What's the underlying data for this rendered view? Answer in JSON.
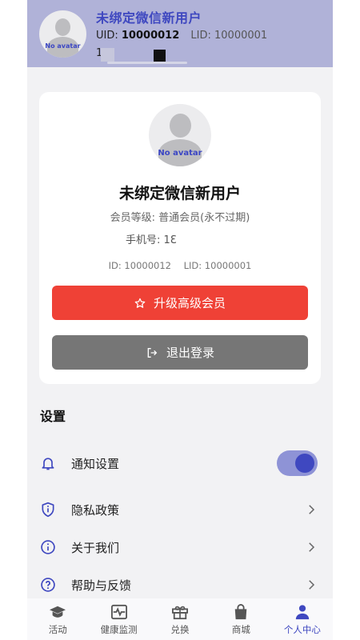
{
  "header": {
    "avatar_text": "No avatar",
    "name": "未绑定微信新用户",
    "uid_label": "UID:",
    "uid": "10000012",
    "lid": "LID: 10000001",
    "phone_partial": "1"
  },
  "card": {
    "avatar_text": "No avatar",
    "name": "未绑定微信新用户",
    "member_level": "会员等级: 普通会员(永不过期)",
    "phone": "手机号: 1Ɛ",
    "id": "ID: 10000012",
    "lid": "LID: 10000001",
    "upgrade_label": "升级高级会员",
    "logout_label": "退出登录"
  },
  "settings": {
    "title": "设置",
    "items": [
      {
        "label": "通知设置",
        "icon": "bell-icon",
        "control": "toggle",
        "on": true
      },
      {
        "label": "隐私政策",
        "icon": "shield-info-icon",
        "control": "chevron"
      },
      {
        "label": "关于我们",
        "icon": "info-icon",
        "control": "chevron"
      },
      {
        "label": "帮助与反馈",
        "icon": "help-icon",
        "control": "chevron"
      }
    ]
  },
  "nav": {
    "items": [
      {
        "label": "活动",
        "icon": "graduation-cap-icon"
      },
      {
        "label": "健康监测",
        "icon": "heart-rate-icon"
      },
      {
        "label": "兑换",
        "icon": "gift-icon"
      },
      {
        "label": "商城",
        "icon": "shopping-bag-icon"
      },
      {
        "label": "个人中心",
        "icon": "person-icon",
        "active": true
      }
    ]
  },
  "colors": {
    "accent": "#3f48c0",
    "header_bg": "#b0b2d8",
    "upgrade": "#ef4136",
    "logout": "#767676"
  }
}
